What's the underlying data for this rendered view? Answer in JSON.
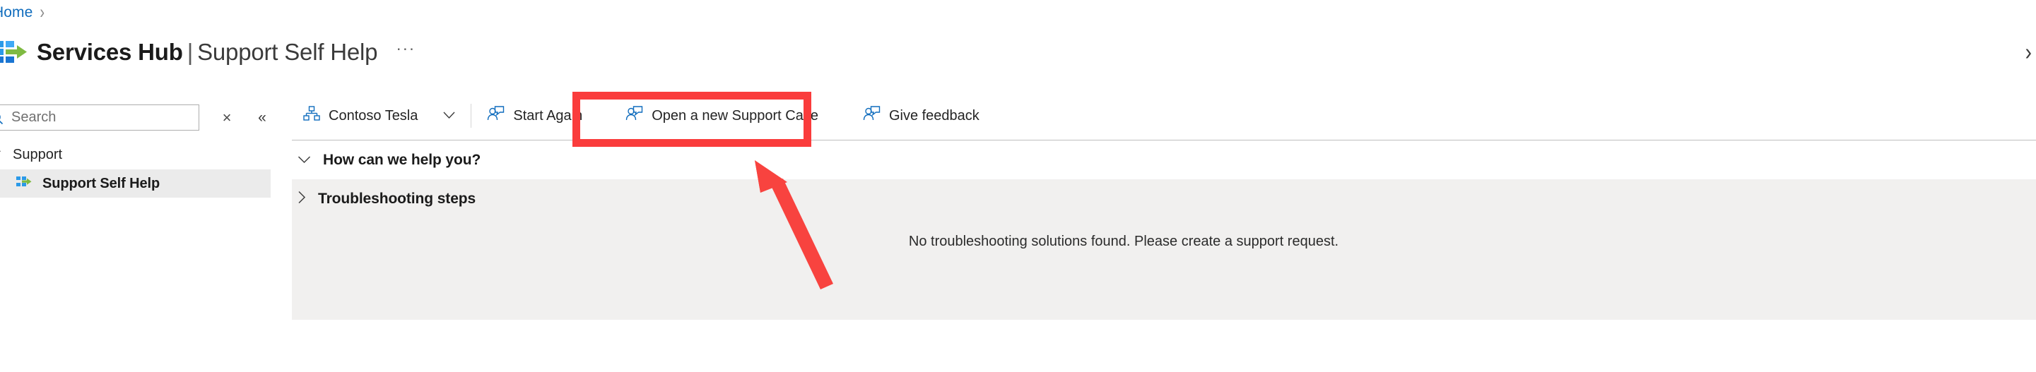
{
  "breadcrumb": {
    "home_label": "Home",
    "separator": "›"
  },
  "header": {
    "logo_icon": "services-hub-logo",
    "title_bold": "Services Hub",
    "title_pipe": "|",
    "title_light": "Support Self Help",
    "overflow_label": "···",
    "right_chevron": "›"
  },
  "sidebar": {
    "search": {
      "icon": "search-icon",
      "placeholder": "Search",
      "value": "",
      "clear_label": "×",
      "collapse_label": "«"
    },
    "group": {
      "chevron": "✓",
      "label": "Support"
    },
    "items": [
      {
        "label": "Support Self Help",
        "icon": "support-self-help-icon",
        "selected": true
      }
    ]
  },
  "toolbar": {
    "items": [
      {
        "label": "Contoso Tesla",
        "icon": "org-hierarchy-icon",
        "caret": "∨",
        "highlighted": false
      },
      {
        "label": "Start Again",
        "icon": "support-case-icon",
        "caret": "",
        "highlighted": false
      },
      {
        "label": "Open a new Support Case",
        "icon": "support-case-icon",
        "caret": "",
        "highlighted": true
      },
      {
        "label": "Give feedback",
        "icon": "support-case-icon",
        "caret": "",
        "highlighted": false
      }
    ]
  },
  "content": {
    "section": {
      "chevron": "∨",
      "title": "How can we help you?",
      "expanded": true
    },
    "panel": {
      "chevron": "›",
      "title": "Troubleshooting steps",
      "expanded": false,
      "empty_message": "No troubleshooting solutions found. Please create a support request."
    }
  },
  "annotations": {
    "highlight_color": "#fa3c3c",
    "box_target": "Open a new Support Case",
    "arrow_target": "Open a new Support Case"
  },
  "colors": {
    "link": "#0f6cbd",
    "accent_blue": "#0f6cbd",
    "panel_bg": "#f1f0ef",
    "selected_bg": "#ebebeb",
    "annotation_red": "#fa3c3c",
    "logo_green": "#7fba42",
    "logo_blue": "#2b9ae8"
  }
}
